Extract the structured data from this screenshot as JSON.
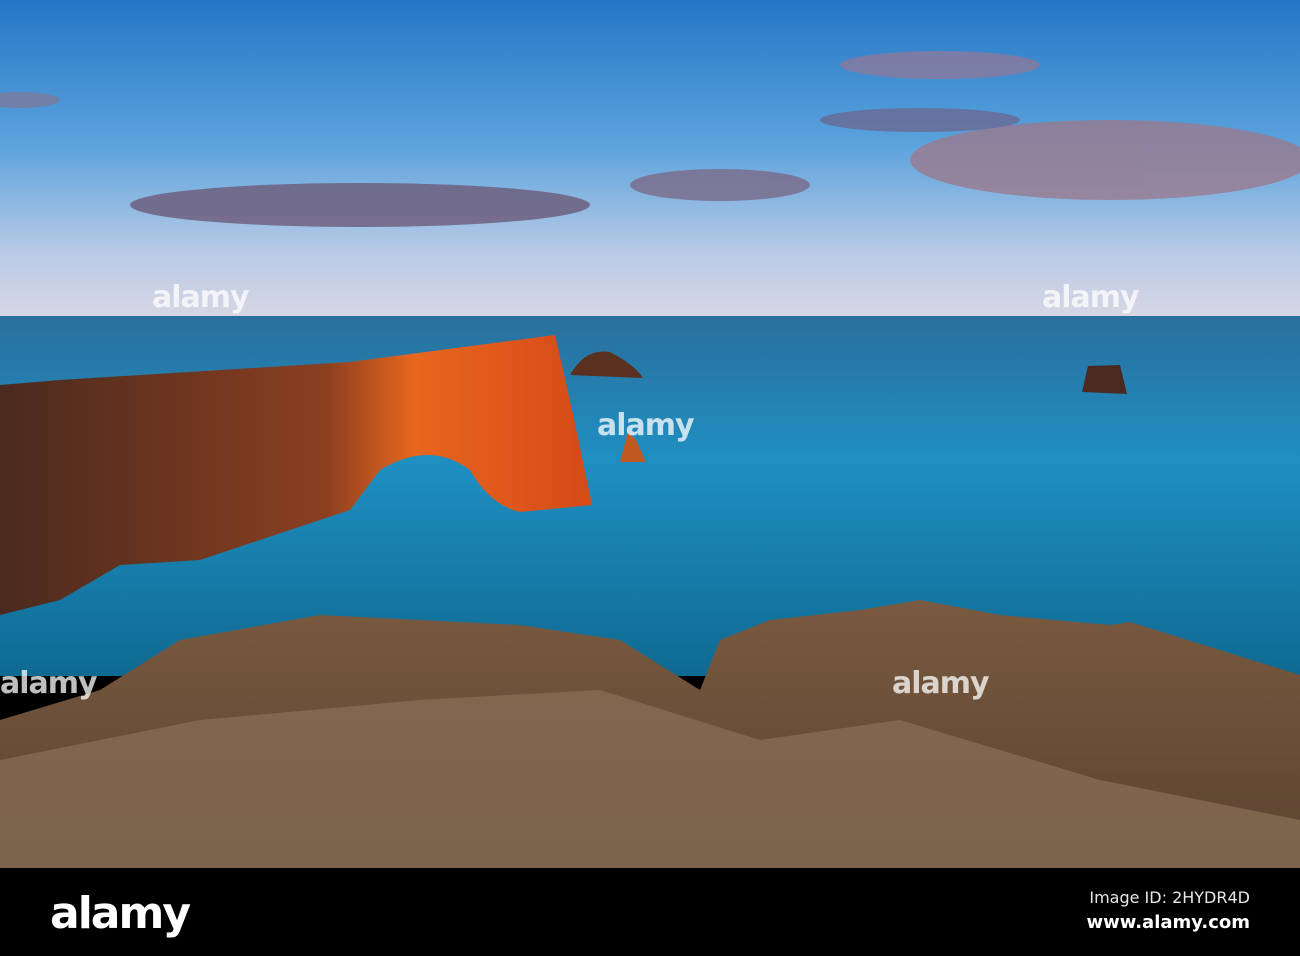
{
  "photo": {
    "subject": "sea-arch-cliff-at-dusk",
    "colors": {
      "sky_top": "#2a7fc9",
      "sky_horizon": "#c9d4e6",
      "sea": "#1b7fb0",
      "arch": "#d9541c",
      "ground": "#6b4a2e"
    }
  },
  "watermark": {
    "text": "alamy"
  },
  "footer": {
    "logo": "alamy",
    "image_id": "Image ID: 2HYDR4D",
    "website": "www.alamy.com"
  }
}
